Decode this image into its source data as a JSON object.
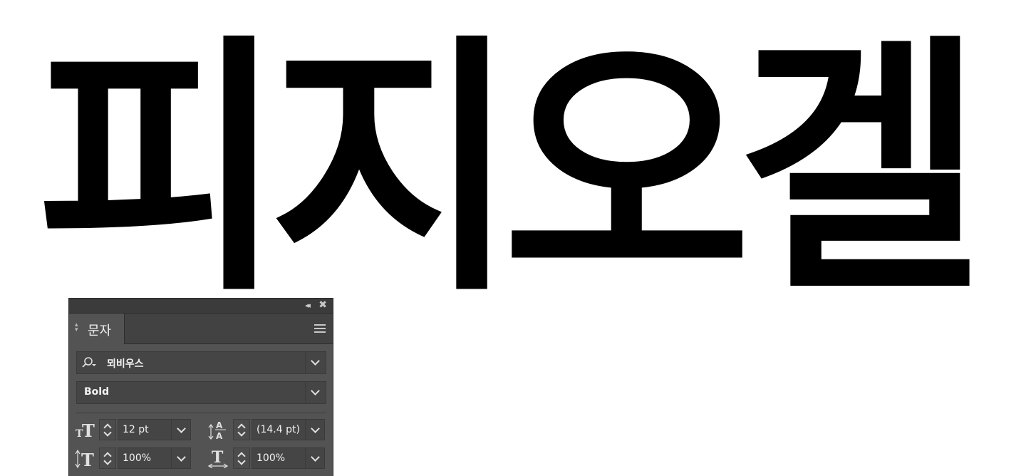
{
  "document": {
    "text": "피지오겔"
  },
  "panel": {
    "tab_label": "문자",
    "collapse_glyph": "◂◂",
    "close_glyph": "✖",
    "font_family": {
      "value": "뫼비우스",
      "icon": "search-icon"
    },
    "font_style": {
      "value": "Bold"
    },
    "font_size": {
      "value": "12 pt",
      "icon": "font-size-icon"
    },
    "leading": {
      "value": "(14.4 pt)",
      "icon": "leading-icon"
    },
    "vertical_scale": {
      "value": "100%",
      "icon": "vertical-scale-icon"
    },
    "horizontal_scale": {
      "value": "100%",
      "icon": "horizontal-scale-icon"
    }
  },
  "colors": {
    "panel_bg": "#535353",
    "titlebar_bg": "#3b3b3b",
    "field_bg": "#454545",
    "text_light": "#f2f2f2",
    "canvas_bg": "#ffffff",
    "hero_text": "#000000"
  }
}
